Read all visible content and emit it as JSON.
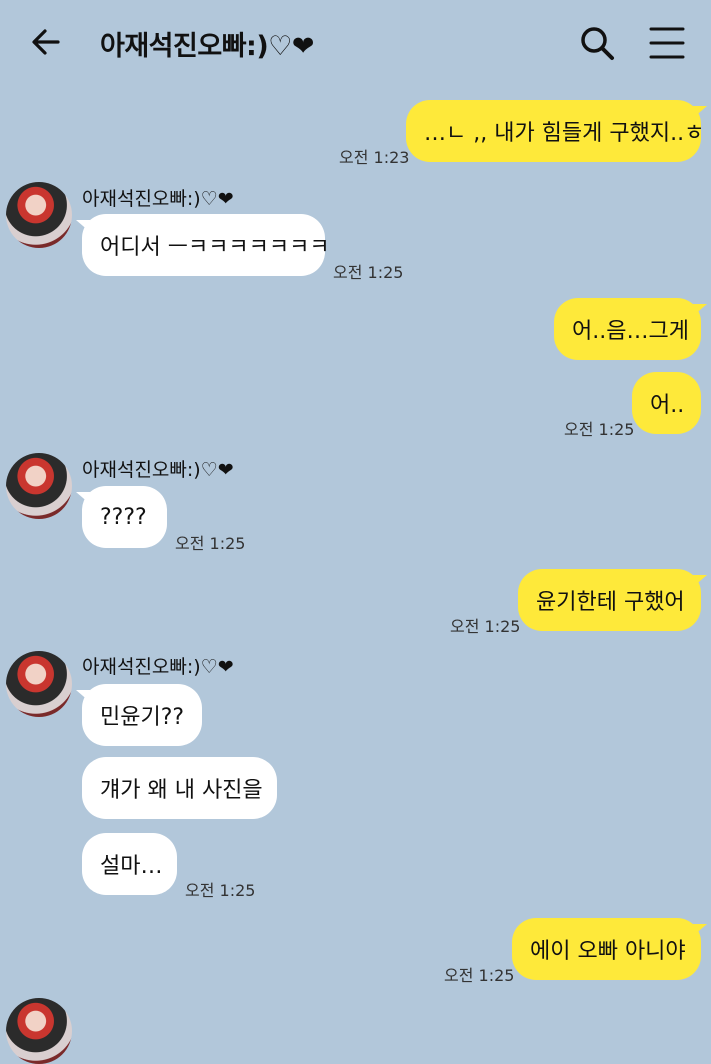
{
  "header": {
    "title": "아재석진오빠:)♡❤",
    "back_icon": "back-arrow-icon",
    "search_icon": "search-icon",
    "menu_icon": "hamburger-menu-icon"
  },
  "colors": {
    "background": "#b2c7da",
    "my_bubble": "#fee93a",
    "their_bubble": "#ffffff"
  },
  "contact_name": "아재석진오빠:)♡❤",
  "messages": [
    {
      "from": "me",
      "text": "…ㄴ ,, 내가 힘들게 구했지..ㅎ",
      "time": "오전 1:23"
    },
    {
      "from": "them",
      "text": "어디서 ㅡㅋㅋㅋㅋㅋㅋㅋ",
      "time": "오전 1:25"
    },
    {
      "from": "me",
      "text": "어..음…그게",
      "time": ""
    },
    {
      "from": "me",
      "text": "어..",
      "time": "오전 1:25"
    },
    {
      "from": "them",
      "text": "????",
      "time": "오전 1:25"
    },
    {
      "from": "me",
      "text": "윤기한테 구했어",
      "time": "오전 1:25"
    },
    {
      "from": "them",
      "text": "민윤기??",
      "time": ""
    },
    {
      "from": "them",
      "text": "걔가 왜 내 사진을",
      "time": ""
    },
    {
      "from": "them",
      "text": "설마…",
      "time": "오전 1:25"
    },
    {
      "from": "me",
      "text": "에이 오빠 아니야",
      "time": "오전 1:25"
    }
  ]
}
